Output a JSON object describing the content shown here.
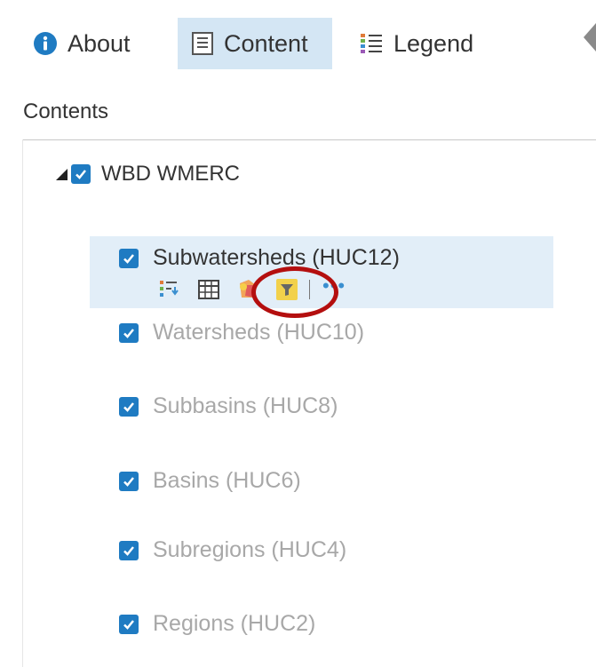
{
  "tabs": {
    "about": "About",
    "content": "Content",
    "legend": "Legend"
  },
  "section_title": "Contents",
  "group": {
    "label": "WBD WMERC",
    "checked": true,
    "expanded": true
  },
  "layers": [
    {
      "label": "Subwatersheds (HUC12)",
      "checked": true,
      "state": "selected"
    },
    {
      "label": "Watersheds (HUC10)",
      "checked": true,
      "state": "dim"
    },
    {
      "label": "Subbasins (HUC8)",
      "checked": true,
      "state": "dim"
    },
    {
      "label": "Basins (HUC6)",
      "checked": true,
      "state": "dim"
    },
    {
      "label": "Subregions (HUC4)",
      "checked": true,
      "state": "dim"
    },
    {
      "label": "Regions (HUC2)",
      "checked": true,
      "state": "dim"
    }
  ],
  "layer_tools": {
    "icons": [
      "legend-expand-icon",
      "attribute-table-icon",
      "change-style-icon",
      "filter-icon",
      "more-options-icon"
    ],
    "more_label": "•••"
  },
  "colors": {
    "accent": "#1f7bc2",
    "selected_tab": "#d4e6f4",
    "selected_row": "#e2eef8",
    "annotation_ring": "#b40f0f"
  }
}
